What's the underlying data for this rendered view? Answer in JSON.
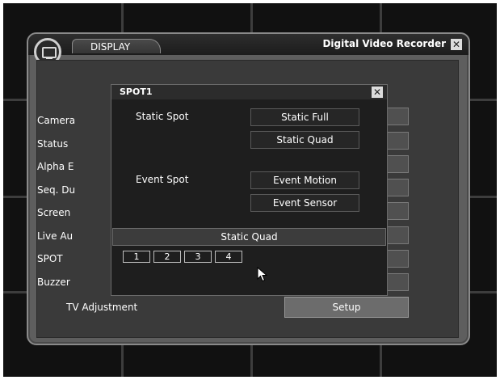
{
  "window": {
    "tab_label": "DISPLAY",
    "title": "Digital Video Recorder",
    "close_glyph": "✕"
  },
  "menu": {
    "items": [
      {
        "label": "Camera"
      },
      {
        "label": "Status"
      },
      {
        "label": "Alpha E"
      },
      {
        "label": "Seq. Du"
      },
      {
        "label": "Screen"
      },
      {
        "label": "Live Au"
      },
      {
        "label": "SPOT"
      },
      {
        "label": "Buzzer"
      }
    ],
    "tv_adjustment_label": "TV Adjustment",
    "setup_label": "Setup"
  },
  "spot_dialog": {
    "title": "SPOT1",
    "close_glyph": "✕",
    "static_spot_label": "Static Spot",
    "event_spot_label": "Event Spot",
    "options": {
      "static_full": "Static Full",
      "static_quad": "Static Quad",
      "event_motion": "Event Motion",
      "event_sensor": "Event Sensor"
    },
    "current_mode": "Static Quad",
    "channels": [
      "1",
      "2",
      "3",
      "4"
    ]
  },
  "icons": [
    "monitor-icon",
    "close-icon",
    "mouse-pointer-icon"
  ],
  "colors": {
    "background": "#111111",
    "window": "#5e5e5e",
    "dialog": "#1e1e1e",
    "text": "#ffffff"
  }
}
